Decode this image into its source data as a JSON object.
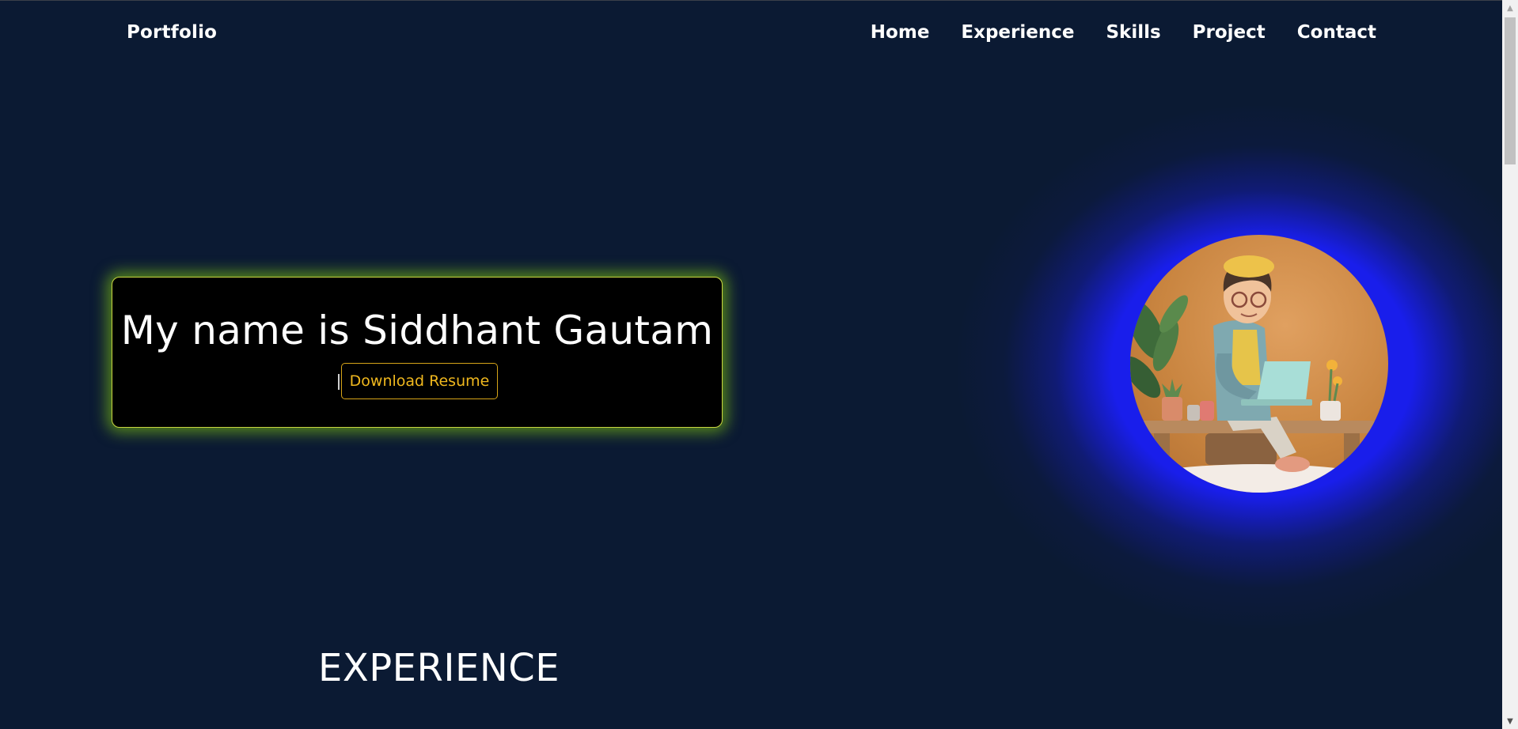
{
  "nav": {
    "brand": "Portfolio",
    "links": [
      "Home",
      "Experience",
      "Skills",
      "Project",
      "Contact"
    ]
  },
  "hero": {
    "title": "My name is Siddhant Gautam",
    "button_label": "Download Resume"
  },
  "sections": {
    "experience_title": "EXPERIENCE"
  },
  "colors": {
    "background": "#0b1a33",
    "card_glow": "#6eaa14",
    "button_accent": "#f0b81e",
    "avatar_glow": "#191ee b"
  },
  "avatar": {
    "icon": "developer-avatar-illustration"
  },
  "scrollbar": {
    "position_fraction": 0
  }
}
